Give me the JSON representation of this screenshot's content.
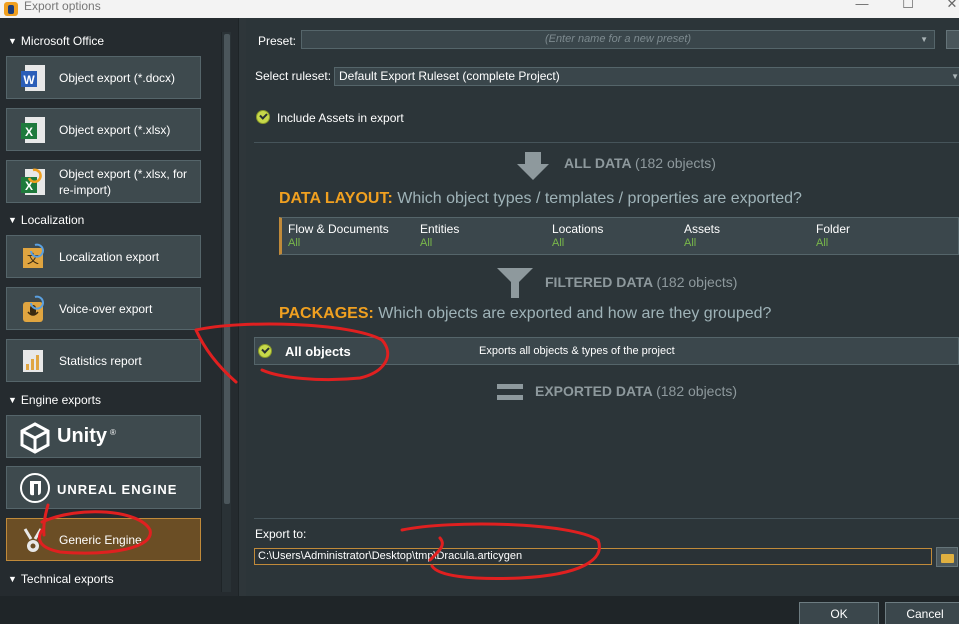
{
  "window": {
    "title": "Export options",
    "minimize": "—",
    "maximize": "☐",
    "close": "✕"
  },
  "left_panel": {
    "sections": [
      {
        "title": "Microsoft Office"
      },
      {
        "title": "Localization"
      },
      {
        "title": "Engine exports"
      },
      {
        "title": "Technical exports"
      }
    ],
    "buttons": {
      "docx": "Object export (*.docx)",
      "xlsx": "Object export (*.xlsx)",
      "xlsx_reimport": "Object export (*.xlsx, for re-import)",
      "localization": "Localization export",
      "voiceover": "Voice-over export",
      "statistics": "Statistics report",
      "unity": "Unity",
      "unreal": "UNREAL ENGINE",
      "generic": "Generic Engine"
    },
    "icon_letters": {
      "word": "W",
      "excel": "X",
      "loc": "文"
    }
  },
  "preset": {
    "label": "Preset:",
    "placeholder": "(Enter name for a new preset)"
  },
  "ruleset": {
    "label": "Select ruleset:",
    "value": "Default Export Ruleset (complete Project)"
  },
  "include_assets": {
    "label": "Include Assets in export",
    "checked": true
  },
  "flow": {
    "all_data": {
      "label": "ALL DATA",
      "count": "(182 objects)"
    },
    "filtered_data": {
      "label": "FILTERED DATA",
      "count": "(182 objects)"
    },
    "exported_data": {
      "label": "EXPORTED DATA",
      "count": "(182 objects)"
    }
  },
  "data_layout": {
    "heading": "DATA LAYOUT:",
    "question": "Which object types / templates / properties are exported?",
    "columns": [
      {
        "name": "Flow & Documents",
        "value": "All"
      },
      {
        "name": "Entities",
        "value": "All"
      },
      {
        "name": "Locations",
        "value": "All"
      },
      {
        "name": "Assets",
        "value": "All"
      },
      {
        "name": "Folder",
        "value": "All"
      }
    ]
  },
  "packages": {
    "heading": "PACKAGES:",
    "question": "Which objects are exported and how are they grouped?",
    "items": [
      {
        "name": "All objects",
        "description": "Exports all objects & types of the project",
        "checked": true
      }
    ]
  },
  "export_to": {
    "label": "Export to:",
    "path": "C:\\Users\\Administrator\\Desktop\\tmp\\Dracula.articygen"
  },
  "dialog": {
    "ok": "OK",
    "cancel": "Cancel"
  },
  "colors": {
    "accent": "#f0a020",
    "active_button": "#6b4e25",
    "value_green": "#79b84a",
    "annotation_red": "#e02020"
  }
}
